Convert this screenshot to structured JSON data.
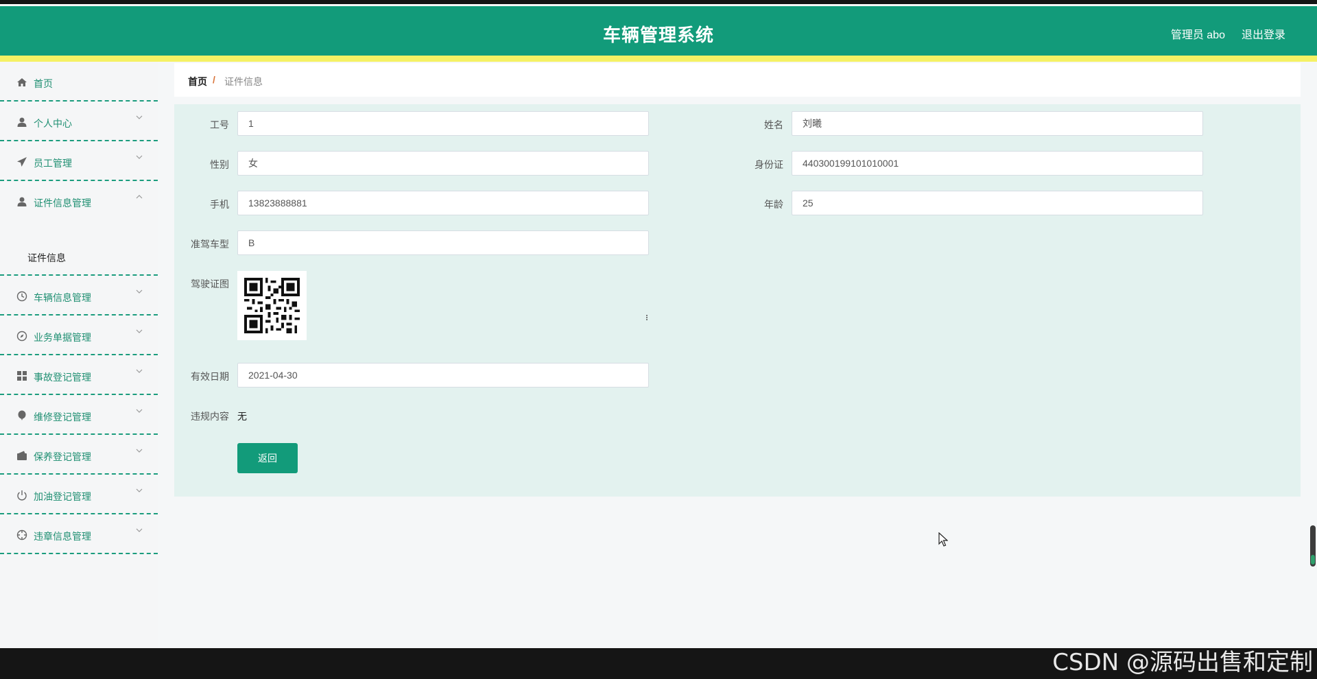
{
  "header": {
    "title": "车辆管理系统",
    "user": "管理员 abo",
    "logout": "退出登录"
  },
  "sidebar": {
    "items": [
      {
        "label": "首页",
        "icon": "home-icon"
      },
      {
        "label": "个人中心",
        "icon": "user-icon"
      },
      {
        "label": "员工管理",
        "icon": "send-icon"
      },
      {
        "label": "证件信息管理",
        "icon": "user-icon"
      },
      {
        "label": "车辆信息管理",
        "icon": "clock-icon"
      },
      {
        "label": "业务单据管理",
        "icon": "compass-icon"
      },
      {
        "label": "事故登记管理",
        "icon": "grid-icon"
      },
      {
        "label": "维修登记管理",
        "icon": "balloon-icon"
      },
      {
        "label": "保养登记管理",
        "icon": "wallet-icon"
      },
      {
        "label": "加油登记管理",
        "icon": "power-icon"
      },
      {
        "label": "违章信息管理",
        "icon": "crosshair-icon"
      }
    ],
    "submenu": {
      "label": "证件信息"
    }
  },
  "breadcrumb": {
    "home": "首页",
    "separator": "/",
    "current": "证件信息"
  },
  "form": {
    "employee_no": {
      "label": "工号",
      "value": "1"
    },
    "name": {
      "label": "姓名",
      "value": "刘曦"
    },
    "gender": {
      "label": "性别",
      "value": "女"
    },
    "id_card": {
      "label": "身份证",
      "value": "440300199101010001"
    },
    "phone": {
      "label": "手机",
      "value": "13823888881"
    },
    "age": {
      "label": "年龄",
      "value": "25"
    },
    "license_type": {
      "label": "准驾车型",
      "value": "B"
    },
    "license_image": {
      "label": "驾驶证图"
    },
    "valid_date": {
      "label": "有效日期",
      "value": "2021-04-30"
    },
    "violation": {
      "label": "违规内容",
      "value": "无"
    },
    "back_button": "返回"
  },
  "watermark": "CSDN @源码出售和定制",
  "colors": {
    "primary": "#129b7a",
    "accent_bar": "#f5f164",
    "content_bg": "#e3f2ef",
    "breadcrumb_separator": "#d9743a"
  }
}
